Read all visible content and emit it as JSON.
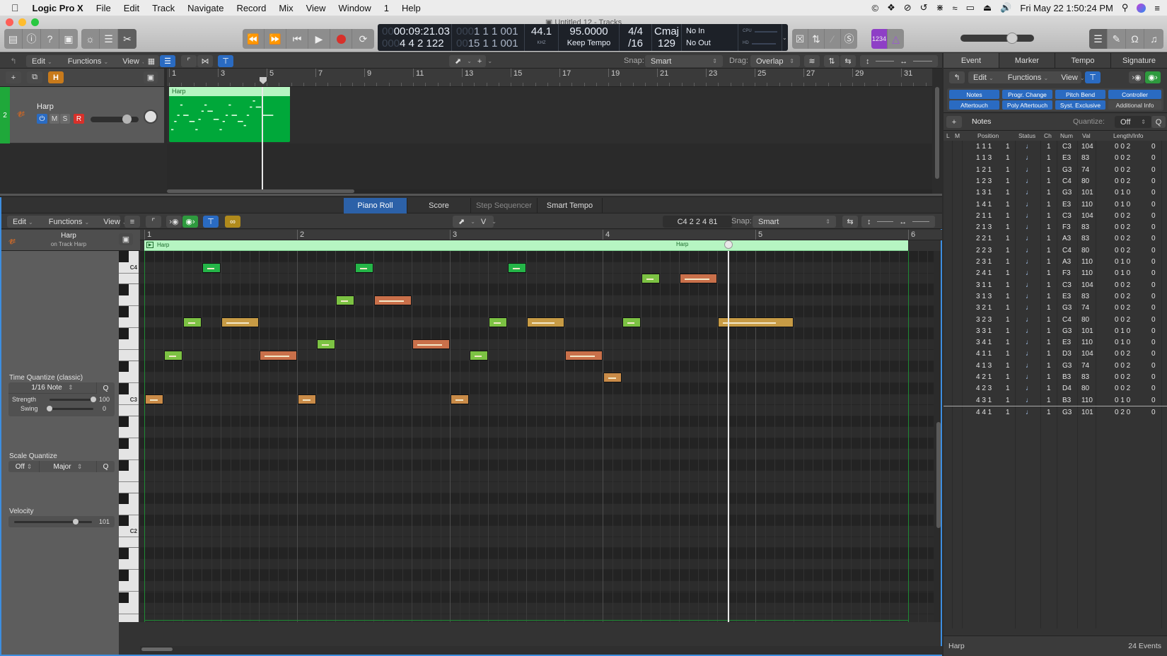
{
  "menubar": {
    "apple": "",
    "app": "Logic Pro X",
    "items": [
      "File",
      "Edit",
      "Track",
      "Navigate",
      "Record",
      "Mix",
      "View",
      "Window",
      "1",
      "Help"
    ],
    "status_icons": [
      "creative-cloud-icon",
      "dropbox-icon",
      "sync-icon",
      "time-machine-icon",
      "bluetooth-icon",
      "wifi-icon",
      "airplay-icon",
      "eject-icon",
      "volume-icon"
    ],
    "clock": "Fri May 22  1:50:24 PM"
  },
  "window": {
    "title": "Untitled 12 - Tracks"
  },
  "transport": {
    "time": "00:09:21.03",
    "time_prefix": "00",
    "bars": "4  4  2  122",
    "bars_prefix": "000",
    "locator_start": "1  1  1  001",
    "locator_start_prefix": "000",
    "locator_end": "15  1  1  001",
    "locator_end_prefix": "00",
    "sample_rate": "44.1",
    "sample_rate_unit": "KHZ",
    "tempo": "95.0000",
    "tempo_mode": "Keep Tempo",
    "signature": "4/4",
    "division": "/16",
    "key": "Cmaj",
    "key_value": "129",
    "midi_in": "No In",
    "midi_out": "No Out",
    "cpu_label": "CPU",
    "hd_label": "HD",
    "count_in_label": "1234"
  },
  "master_volume": 0.7,
  "tracks_toolbar": {
    "edit": "Edit",
    "functions": "Functions",
    "view": "View",
    "snap_label": "Snap:",
    "snap_value": "Smart",
    "drag_label": "Drag:",
    "drag_value": "Overlap"
  },
  "tracks_ruler": [
    "1",
    "3",
    "5",
    "7",
    "9",
    "11",
    "13",
    "15",
    "17",
    "19",
    "21",
    "23",
    "25",
    "27",
    "29",
    "31"
  ],
  "track": {
    "number": "2",
    "name": "Harp",
    "mute": "M",
    "solo": "S",
    "record": "R",
    "color": "#1fa83a",
    "volume": 0.75,
    "region_name": "Harp"
  },
  "editor": {
    "tabs": [
      {
        "label": "Piano Roll",
        "active": true
      },
      {
        "label": "Score",
        "active": false
      },
      {
        "label": "Step Sequencer",
        "active": false
      },
      {
        "label": "Smart Tempo",
        "active": false
      }
    ],
    "toolbar": {
      "edit": "Edit",
      "functions": "Functions",
      "view": "View",
      "tool_secondary": "V",
      "position_readout": "C4  2 2 4 81",
      "snap_label": "Snap:",
      "snap_value": "Smart"
    },
    "ruler": [
      "1",
      "2",
      "3",
      "4",
      "5",
      "6"
    ],
    "region_label": "Harp",
    "region_label_2": "Harp",
    "inspector": {
      "region_name": "Harp",
      "region_sub": "on Track Harp",
      "time_quantize_title": "Time Quantize (classic)",
      "time_quantize_value": "1/16 Note",
      "q_button": "Q",
      "strength_label": "Strength",
      "strength_value": "100",
      "swing_label": "Swing",
      "swing_value": "0",
      "scale_quantize_title": "Scale Quantize",
      "scale_quantize_off": "Off",
      "scale_quantize_scale": "Major",
      "velocity_title": "Velocity",
      "velocity_value": "101"
    },
    "key_labels": {
      "c4": "C4",
      "c3": "C3",
      "c2": "C2"
    },
    "playhead_bar": 4.82,
    "notes": [
      {
        "pitch": "C3",
        "start": "1 1 1",
        "len16": 2,
        "vel": 104
      },
      {
        "pitch": "E3",
        "start": "1 1 3",
        "len16": 2,
        "vel": 83
      },
      {
        "pitch": "G3",
        "start": "1 2 1",
        "len16": 2,
        "vel": 74
      },
      {
        "pitch": "C4",
        "start": "1 2 3",
        "len16": 2,
        "vel": 80
      },
      {
        "pitch": "G3",
        "start": "1 3 1",
        "len16": 4,
        "vel": 101
      },
      {
        "pitch": "E3",
        "start": "1 4 1",
        "len16": 4,
        "vel": 110
      },
      {
        "pitch": "C3",
        "start": "2 1 1",
        "len16": 2,
        "vel": 104
      },
      {
        "pitch": "F3",
        "start": "2 1 3",
        "len16": 2,
        "vel": 83
      },
      {
        "pitch": "A3",
        "start": "2 2 1",
        "len16": 2,
        "vel": 83
      },
      {
        "pitch": "C4",
        "start": "2 2 3",
        "len16": 2,
        "vel": 80
      },
      {
        "pitch": "A3",
        "start": "2 3 1",
        "len16": 4,
        "vel": 110
      },
      {
        "pitch": "F3",
        "start": "2 4 1",
        "len16": 4,
        "vel": 110
      },
      {
        "pitch": "C3",
        "start": "3 1 1",
        "len16": 2,
        "vel": 104
      },
      {
        "pitch": "E3",
        "start": "3 1 3",
        "len16": 2,
        "vel": 83
      },
      {
        "pitch": "G3",
        "start": "3 2 1",
        "len16": 2,
        "vel": 74
      },
      {
        "pitch": "C4",
        "start": "3 2 3",
        "len16": 2,
        "vel": 80
      },
      {
        "pitch": "G3",
        "start": "3 3 1",
        "len16": 4,
        "vel": 101
      },
      {
        "pitch": "E3",
        "start": "3 4 1",
        "len16": 4,
        "vel": 110
      },
      {
        "pitch": "D3",
        "start": "4 1 1",
        "len16": 2,
        "vel": 104
      },
      {
        "pitch": "G3",
        "start": "4 1 3",
        "len16": 2,
        "vel": 74
      },
      {
        "pitch": "B3",
        "start": "4 2 1",
        "len16": 2,
        "vel": 83
      },
      {
        "pitch": "D4",
        "start": "4 2 3",
        "len16": 2,
        "vel": 80
      },
      {
        "pitch": "B3",
        "start": "4 3 1",
        "len16": 4,
        "vel": 110
      },
      {
        "pitch": "G3",
        "start": "4 4 1",
        "len16": 8,
        "vel": 101
      }
    ]
  },
  "event_list": {
    "tabs": [
      "Event",
      "Marker",
      "Tempo",
      "Signature"
    ],
    "active_tab": "Event",
    "edit": "Edit",
    "functions": "Functions",
    "view": "View",
    "filters": [
      {
        "label": "Notes",
        "on": true
      },
      {
        "label": "Progr. Change",
        "on": true
      },
      {
        "label": "Pitch Bend",
        "on": true
      },
      {
        "label": "Controller",
        "on": true
      },
      {
        "label": "Aftertouch",
        "on": true
      },
      {
        "label": "Poly Aftertouch",
        "on": true
      },
      {
        "label": "Syst. Exclusive",
        "on": true
      },
      {
        "label": "Additional Info",
        "on": false
      }
    ],
    "type_label": "Notes",
    "quantize_label": "Quantize:",
    "quantize_value": "Off",
    "q_button": "Q",
    "columns": [
      "L",
      "M",
      "Position",
      "Status",
      "Ch",
      "Num",
      "Val",
      "Length/Info"
    ],
    "rows": [
      {
        "pos": "1  1  1",
        "tick": "1",
        "status": "♩",
        "ch": "1",
        "num": "C3",
        "val": "104",
        "len": "0  0  2",
        "info": "0"
      },
      {
        "pos": "1  1  3",
        "tick": "1",
        "status": "♩",
        "ch": "1",
        "num": "E3",
        "val": "83",
        "len": "0  0  2",
        "info": "0"
      },
      {
        "pos": "1  2  1",
        "tick": "1",
        "status": "♩",
        "ch": "1",
        "num": "G3",
        "val": "74",
        "len": "0  0  2",
        "info": "0"
      },
      {
        "pos": "1  2  3",
        "tick": "1",
        "status": "♩",
        "ch": "1",
        "num": "C4",
        "val": "80",
        "len": "0  0  2",
        "info": "0"
      },
      {
        "pos": "1  3  1",
        "tick": "1",
        "status": "♩",
        "ch": "1",
        "num": "G3",
        "val": "101",
        "len": "0  1  0",
        "info": "0"
      },
      {
        "pos": "1  4  1",
        "tick": "1",
        "status": "♩",
        "ch": "1",
        "num": "E3",
        "val": "110",
        "len": "0  1  0",
        "info": "0"
      },
      {
        "pos": "2  1  1",
        "tick": "1",
        "status": "♩",
        "ch": "1",
        "num": "C3",
        "val": "104",
        "len": "0  0  2",
        "info": "0"
      },
      {
        "pos": "2  1  3",
        "tick": "1",
        "status": "♩",
        "ch": "1",
        "num": "F3",
        "val": "83",
        "len": "0  0  2",
        "info": "0"
      },
      {
        "pos": "2  2  1",
        "tick": "1",
        "status": "♩",
        "ch": "1",
        "num": "A3",
        "val": "83",
        "len": "0  0  2",
        "info": "0"
      },
      {
        "pos": "2  2  3",
        "tick": "1",
        "status": "♩",
        "ch": "1",
        "num": "C4",
        "val": "80",
        "len": "0  0  2",
        "info": "0"
      },
      {
        "pos": "2  3  1",
        "tick": "1",
        "status": "♩",
        "ch": "1",
        "num": "A3",
        "val": "110",
        "len": "0  1  0",
        "info": "0"
      },
      {
        "pos": "2  4  1",
        "tick": "1",
        "status": "♩",
        "ch": "1",
        "num": "F3",
        "val": "110",
        "len": "0  1  0",
        "info": "0"
      },
      {
        "pos": "3  1  1",
        "tick": "1",
        "status": "♩",
        "ch": "1",
        "num": "C3",
        "val": "104",
        "len": "0  0  2",
        "info": "0"
      },
      {
        "pos": "3  1  3",
        "tick": "1",
        "status": "♩",
        "ch": "1",
        "num": "E3",
        "val": "83",
        "len": "0  0  2",
        "info": "0"
      },
      {
        "pos": "3  2  1",
        "tick": "1",
        "status": "♩",
        "ch": "1",
        "num": "G3",
        "val": "74",
        "len": "0  0  2",
        "info": "0"
      },
      {
        "pos": "3  2  3",
        "tick": "1",
        "status": "♩",
        "ch": "1",
        "num": "C4",
        "val": "80",
        "len": "0  0  2",
        "info": "0"
      },
      {
        "pos": "3  3  1",
        "tick": "1",
        "status": "♩",
        "ch": "1",
        "num": "G3",
        "val": "101",
        "len": "0  1  0",
        "info": "0"
      },
      {
        "pos": "3  4  1",
        "tick": "1",
        "status": "♩",
        "ch": "1",
        "num": "E3",
        "val": "110",
        "len": "0  1  0",
        "info": "0"
      },
      {
        "pos": "4  1  1",
        "tick": "1",
        "status": "♩",
        "ch": "1",
        "num": "D3",
        "val": "104",
        "len": "0  0  2",
        "info": "0"
      },
      {
        "pos": "4  1  3",
        "tick": "1",
        "status": "♩",
        "ch": "1",
        "num": "G3",
        "val": "74",
        "len": "0  0  2",
        "info": "0"
      },
      {
        "pos": "4  2  1",
        "tick": "1",
        "status": "♩",
        "ch": "1",
        "num": "B3",
        "val": "83",
        "len": "0  0  2",
        "info": "0"
      },
      {
        "pos": "4  2  3",
        "tick": "1",
        "status": "♩",
        "ch": "1",
        "num": "D4",
        "val": "80",
        "len": "0  0  2",
        "info": "0"
      },
      {
        "pos": "4  3  1",
        "tick": "1",
        "status": "♩",
        "ch": "1",
        "num": "B3",
        "val": "110",
        "len": "0  1  0",
        "info": "0"
      },
      {
        "pos": "4  4  1",
        "tick": "1",
        "status": "♩",
        "ch": "1",
        "num": "G3",
        "val": "101",
        "len": "0  2  0",
        "info": "0",
        "selected": true
      }
    ],
    "footer_name": "Harp",
    "footer_count": "24 Events"
  },
  "colors": {
    "accent_blue": "#2c61a8",
    "region_green": "#00a83a",
    "region_header": "#b6f5c2",
    "record_red": "#d8302a",
    "count_in_purple": "#8e3fc6"
  }
}
